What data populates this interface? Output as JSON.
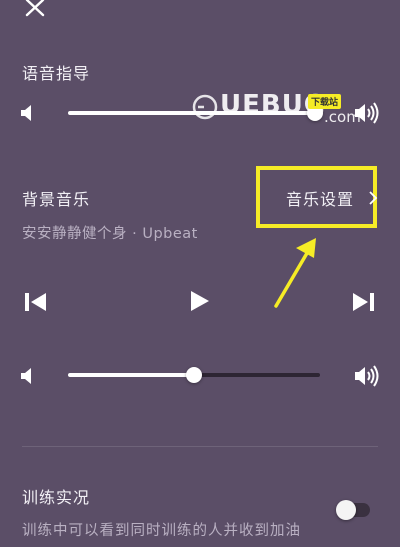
{
  "voice_guide": {
    "label": "语音指导",
    "volume": 0.98
  },
  "background_music": {
    "label": "背景音乐",
    "settings_button_label": "音乐设置",
    "track_name": "安安静静健个身 · Upbeat",
    "volume": 0.5
  },
  "training_live": {
    "label": "训练实况",
    "description": "训练中可以看到同时训练的人并收到加油",
    "enabled": false
  },
  "watermark": {
    "text": "UEBUG",
    "suffix": ".com",
    "badge": "下载站"
  },
  "colors": {
    "background": "#5b4e67",
    "highlight": "#f6ec26",
    "track": "#2d2533"
  }
}
